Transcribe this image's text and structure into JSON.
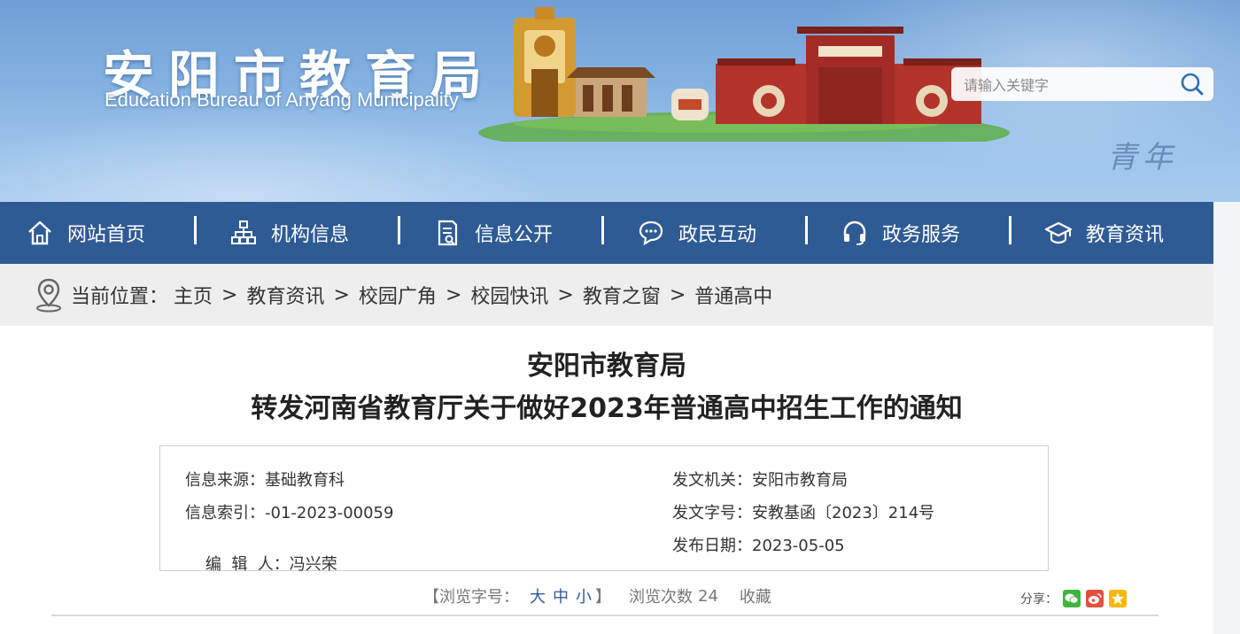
{
  "header": {
    "site_title": "安阳市教育局",
    "site_subtitle": "Education Bureau  of Anyang Municipality",
    "calligraphy": "青年",
    "search": {
      "placeholder": "请输入关键字",
      "value": ""
    }
  },
  "nav": {
    "items": [
      {
        "label": "网站首页",
        "icon": "home-icon"
      },
      {
        "label": "机构信息",
        "icon": "org-chart-icon"
      },
      {
        "label": "信息公开",
        "icon": "document-icon"
      },
      {
        "label": "政民互动",
        "icon": "chat-icon"
      },
      {
        "label": "政务服务",
        "icon": "headset-icon"
      },
      {
        "label": "教育资讯",
        "icon": "graduation-cap-icon"
      }
    ]
  },
  "breadcrumb": {
    "prefix": "当前位置：",
    "separator": ">",
    "items": [
      "主页",
      "教育资讯",
      "校园广角",
      "校园快讯",
      "教育之窗",
      "普通高中"
    ]
  },
  "article": {
    "title_line1": "安阳市教育局",
    "title_line2": "转发河南省教育厅关于做好2023年普通高中招生工作的通知",
    "meta": {
      "source_label": "信息来源：",
      "source_value": "基础教育科",
      "index_label": "信息索引：",
      "index_value": "-01-2023-00059",
      "editor_label": "编  辑  人：",
      "editor_value": "冯兴荣",
      "issuer_label": "发文机关：",
      "issuer_value": "安阳市教育局",
      "docno_label": "发文字号：",
      "docno_value": "安教基函〔2023〕214号",
      "date_label": "发布日期：",
      "date_value": "2023-05-05"
    },
    "tools": {
      "font_size_label": "【浏览字号：",
      "size_large": "大",
      "size_medium": "中",
      "size_small": "小",
      "close_bracket": "】",
      "views_label": "浏览次数",
      "views_count": "24",
      "favorite": "收藏"
    },
    "share": {
      "label": "分享：",
      "icons": [
        "wechat-icon",
        "weibo-icon",
        "qzone-icon"
      ]
    }
  },
  "colors": {
    "nav_bg": "#2f5b95",
    "breadcrumb_bg": "#eeeeee",
    "accent_blue": "#2f5b95",
    "wechat": "#3fb53f",
    "weibo": "#e2513c",
    "qzone": "#f5b800"
  }
}
